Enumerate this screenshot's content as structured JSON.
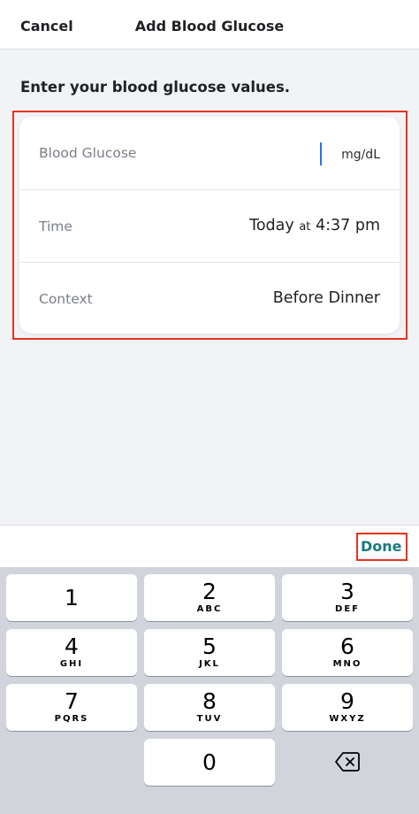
{
  "nav": {
    "cancel_label": "Cancel",
    "title": "Add Blood Glucose"
  },
  "prompt": "Enter your blood glucose values.",
  "form": {
    "blood_glucose": {
      "label": "Blood Glucose",
      "value": "",
      "unit": "mg/dL"
    },
    "time": {
      "label": "Time",
      "day": "Today",
      "at": "at",
      "clock": "4:37 pm"
    },
    "context": {
      "label": "Context",
      "value": "Before Dinner"
    }
  },
  "accessory": {
    "done_label": "Done"
  },
  "keypad": {
    "keys": [
      {
        "digit": "1",
        "letters": ""
      },
      {
        "digit": "2",
        "letters": "ABC"
      },
      {
        "digit": "3",
        "letters": "DEF"
      },
      {
        "digit": "4",
        "letters": "GHI"
      },
      {
        "digit": "5",
        "letters": "JKL"
      },
      {
        "digit": "6",
        "letters": "MNO"
      },
      {
        "digit": "7",
        "letters": "PQRS"
      },
      {
        "digit": "8",
        "letters": "TUV"
      },
      {
        "digit": "9",
        "letters": "WXYZ"
      },
      {
        "digit": "0",
        "letters": ""
      }
    ],
    "delete_icon": "backspace-icon"
  },
  "colors": {
    "accent": "#1a7a7e",
    "highlight": "#e8321e",
    "cursor": "#2a72e6"
  }
}
